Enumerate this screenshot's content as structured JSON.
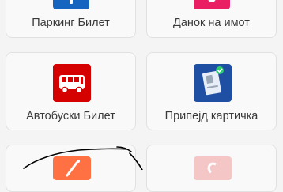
{
  "tiles": [
    {
      "label": "Паркинг Билет",
      "icon": "parking-icon",
      "color": "#1565c0"
    },
    {
      "label": "Данок на имот",
      "icon": "property-tax-icon",
      "color": "#e91e63"
    },
    {
      "label": "Автобуски Билет",
      "icon": "bus-icon",
      "color": "#d50000"
    },
    {
      "label": "Припејд картичка",
      "icon": "prepaid-card-icon",
      "color": "#1e4fa3"
    },
    {
      "label": "",
      "icon": "magic-wand-icon",
      "color": "#ff7043"
    },
    {
      "label": "",
      "icon": "partial-icon",
      "color": "#f5c6c6"
    }
  ]
}
